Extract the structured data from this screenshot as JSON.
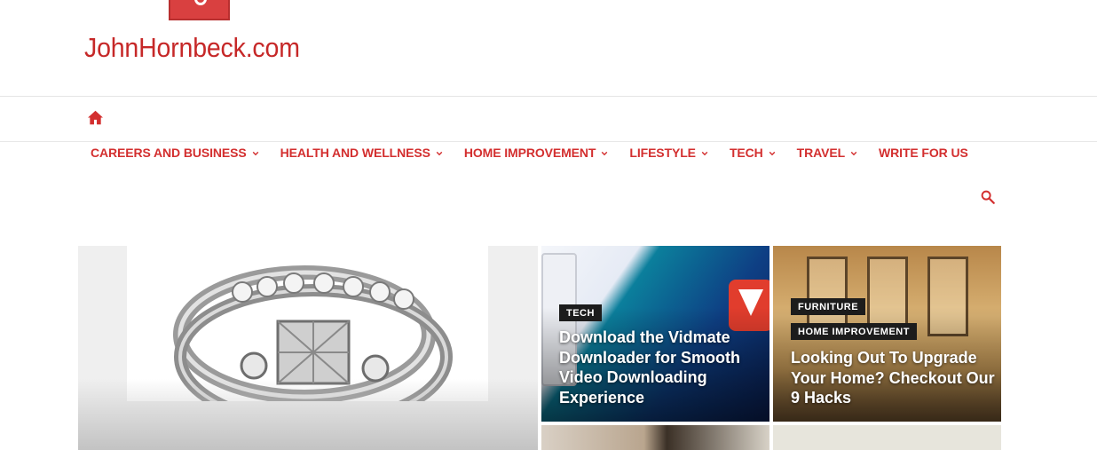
{
  "site": {
    "title": "JohnHornbeck.com"
  },
  "nav": {
    "items": [
      {
        "label": "CAREERS AND BUSINESS",
        "dropdown": true
      },
      {
        "label": "HEALTH AND WELLNESS",
        "dropdown": true
      },
      {
        "label": "HOME IMPROVEMENT",
        "dropdown": true
      },
      {
        "label": "LIFESTYLE",
        "dropdown": true
      },
      {
        "label": "TECH",
        "dropdown": true
      },
      {
        "label": "TRAVEL",
        "dropdown": true
      },
      {
        "label": "WRITE FOR US",
        "dropdown": false
      }
    ]
  },
  "posts": [
    {
      "category": "TECH",
      "title": "Download the Vidmate Downloader for Smooth Video Downloading Experience"
    },
    {
      "categories": [
        "FURNITURE",
        "HOME IMPROVEMENT"
      ],
      "title": "Looking Out To Upgrade Your Home? Checkout Our 9 Hacks"
    }
  ],
  "icons": {
    "home": "home-icon",
    "search": "search-icon",
    "dropdown": "chevron-down-icon"
  },
  "colors": {
    "accent": "#d32f2f",
    "badge": "#1c1c1c"
  }
}
